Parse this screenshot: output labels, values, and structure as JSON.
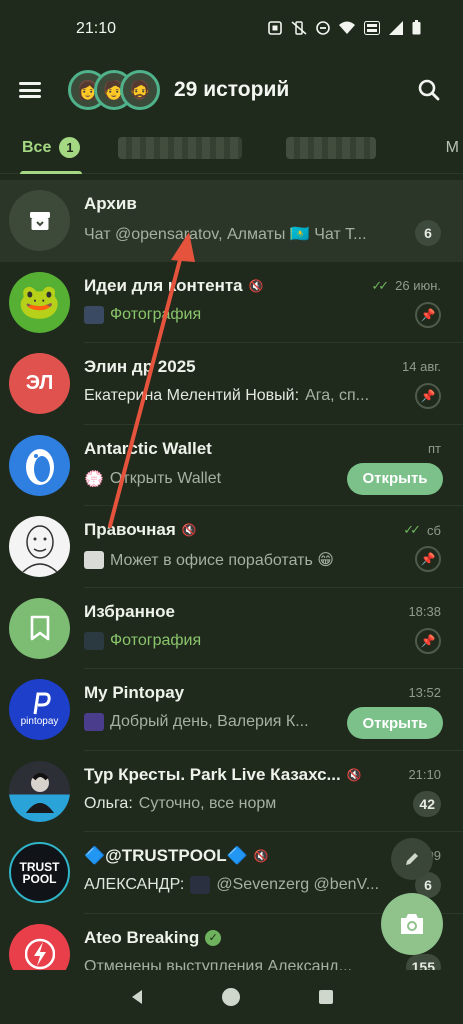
{
  "status_bar": {
    "time": "21:10",
    "icons": [
      "nfc-icon",
      "vibrate-mute-icon",
      "dnd-icon",
      "wifi-icon",
      "volte-icon",
      "signal-icon",
      "battery-icon"
    ]
  },
  "header": {
    "stories_label": "29 историй",
    "story_emojis": [
      "👩",
      "🧑",
      "🧔"
    ]
  },
  "tabs": {
    "active_label": "Все",
    "active_badge": "1",
    "cut_off_label": "М"
  },
  "chats": [
    {
      "title": "Архив",
      "message": "Чат @opensaratov, Алматы 🇰🇿 Чат Т...",
      "count": "6",
      "avatar_bg": "#3d4a3a"
    },
    {
      "title": "Идеи для контента",
      "time": "26 июн.",
      "message_media": "Фотография",
      "avatar_emoji": "🐸",
      "avatar_bg": "#55b034"
    },
    {
      "title": "Элин др 2025",
      "time": "14 авг.",
      "avatar_text": "ЭЛ",
      "message_sender": "Екатерина Мелентий Новый:",
      "message": "Ага, сп...",
      "avatar_bg": "#e0524d"
    },
    {
      "title": "Antarctic Wallet",
      "time": "пт",
      "message": "Открыть Wallet",
      "open_label": "Открыть",
      "avatar_bg": "#2e7fe0"
    },
    {
      "title": "Правочная",
      "time": "сб",
      "message": "Может в офисе поработать 😁",
      "avatar_bg": "#f4f4f4"
    },
    {
      "title": "Избранное",
      "time": "18:38",
      "message_media": "Фотография",
      "avatar_bg": "#7cbd73"
    },
    {
      "title": "My Pintopay",
      "time": "13:52",
      "message": "Добрый день, Валерия К...",
      "open_label": "Открыть",
      "avatar_bg": "#1d3fc9",
      "avatar_caption": "pintopay"
    },
    {
      "title": "Тур Кресты. Park Live Казахс...",
      "time": "21:10",
      "message_sender": "Ольга:",
      "message": "Суточно, все норм",
      "count": "42",
      "avatar_bg": "#1e6aa0"
    },
    {
      "title": "🔷@TRUSTPOOL🔷",
      "time": "09",
      "message_sender": "АЛЕКСАНДР:",
      "message": "@Sevenzerg @benV...",
      "count": "6",
      "avatar_bg": "#101418",
      "avatar_text": "TRUST POOL"
    },
    {
      "title": "Ateo Breaking",
      "message": "Отменены выступления Александ...",
      "count": "155",
      "avatar_bg": "#e83f4a"
    }
  ],
  "colors": {
    "background": "#1f2a1d",
    "accent": "#a4d883",
    "open_button": "#7cc08a",
    "fab": "#8fc38b",
    "annotation_arrow": "#e5533d"
  }
}
